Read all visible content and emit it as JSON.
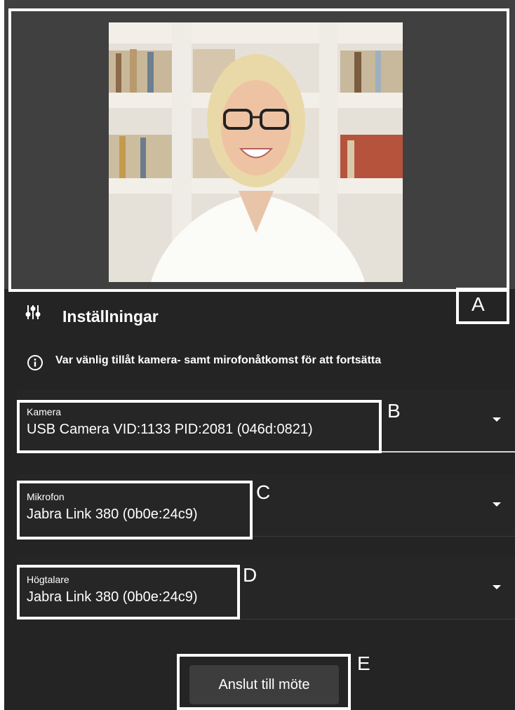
{
  "settings": {
    "title": "Inställningar",
    "notice": "Var vänlig tillåt kamera- samt mirofonåtkomst för att fortsätta"
  },
  "devices": {
    "camera": {
      "label": "Kamera",
      "value": "USB Camera VID:1133 PID:2081 (046d:0821)"
    },
    "microphone": {
      "label": "Mikrofon",
      "value": "Jabra Link 380 (0b0e:24c9)"
    },
    "speaker": {
      "label": "Högtalare",
      "value": "Jabra Link 380 (0b0e:24c9)"
    }
  },
  "join_button": {
    "label": "Anslut till möte"
  },
  "annotations": {
    "a": "A",
    "b": "B",
    "c": "C",
    "d": "D",
    "e": "E"
  },
  "colors": {
    "panel_bg": "#242424",
    "preview_bg": "#404040",
    "button_bg": "#3d3d3d",
    "annotation": "#ffffff"
  }
}
